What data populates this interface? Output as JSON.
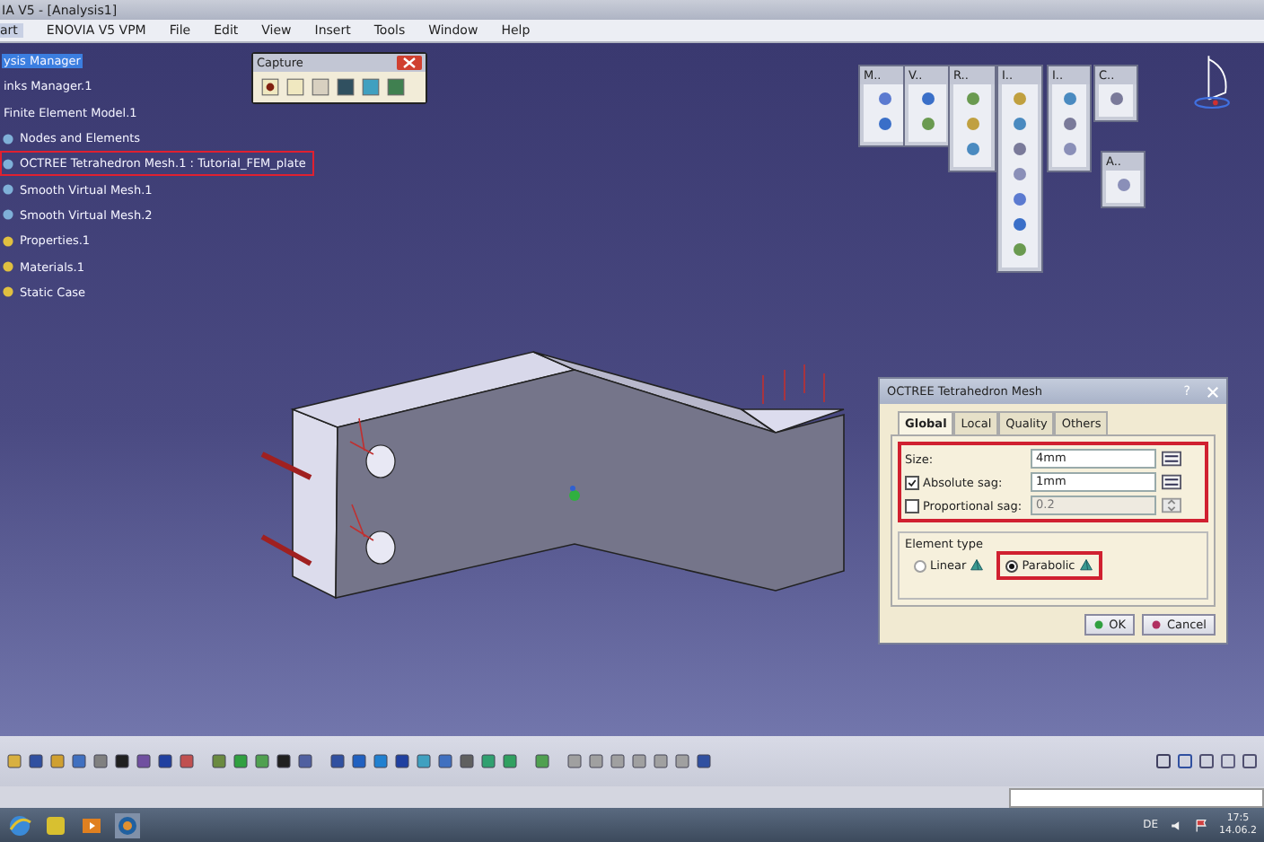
{
  "window": {
    "title": "IA V5 - [Analysis1]"
  },
  "menu": [
    {
      "label": "art",
      "selected": true
    },
    {
      "label": "ENOVIA V5 VPM",
      "selected": false
    },
    {
      "label": "File",
      "selected": false
    },
    {
      "label": "Edit",
      "selected": false
    },
    {
      "label": "View",
      "selected": false
    },
    {
      "label": "Insert",
      "selected": false
    },
    {
      "label": "Tools",
      "selected": false
    },
    {
      "label": "Window",
      "selected": false
    },
    {
      "label": "Help",
      "selected": false
    }
  ],
  "tree": [
    {
      "label": "ysis Manager",
      "selected": true,
      "highlighted": false
    },
    {
      "label": "inks Manager.1",
      "selected": false,
      "highlighted": false
    },
    {
      "label": "Finite Element Model.1",
      "selected": false,
      "highlighted": false
    },
    {
      "label": "Nodes and Elements",
      "selected": false,
      "highlighted": false
    },
    {
      "label": "OCTREE Tetrahedron Mesh.1 : Tutorial_FEM_plate",
      "selected": false,
      "highlighted": true
    },
    {
      "label": "Smooth Virtual Mesh.1",
      "selected": false,
      "highlighted": false
    },
    {
      "label": "Smooth Virtual Mesh.2",
      "selected": false,
      "highlighted": false
    },
    {
      "label": "Properties.1",
      "selected": false,
      "highlighted": false
    },
    {
      "label": "Materials.1",
      "selected": false,
      "highlighted": false
    },
    {
      "label": "Static Case",
      "selected": false,
      "highlighted": false
    }
  ],
  "capture_toolbar": {
    "title": "Capture"
  },
  "floating_toolbars": [
    {
      "title": "M.."
    },
    {
      "title": "V.."
    },
    {
      "title": "R.."
    },
    {
      "title": "I.."
    },
    {
      "title": "I.."
    },
    {
      "title": "C.."
    },
    {
      "title": "A.."
    }
  ],
  "dialog": {
    "title": "OCTREE Tetrahedron Mesh",
    "help": "?",
    "tabs": [
      {
        "label": "Global",
        "selected": true
      },
      {
        "label": "Local",
        "selected": false
      },
      {
        "label": "Quality",
        "selected": false
      },
      {
        "label": "Others",
        "selected": false
      }
    ],
    "fields_highlighted": true,
    "fields": [
      {
        "kind": "plain",
        "label": "Size:",
        "value": "4mm",
        "disabled": false
      },
      {
        "kind": "checkbox",
        "label": "Absolute sag:",
        "checked": true,
        "value": "1mm",
        "disabled": false
      },
      {
        "kind": "checkbox",
        "label": "Proportional sag:",
        "checked": false,
        "value": "0.2",
        "disabled": true
      }
    ],
    "element_type": {
      "legend": "Element type",
      "options": [
        {
          "label": "Linear",
          "selected": false,
          "highlighted": false
        },
        {
          "label": "Parabolic",
          "selected": true,
          "highlighted": true
        }
      ]
    },
    "buttons": [
      "OK",
      "Cancel"
    ]
  },
  "taskbar": {
    "language": "DE",
    "time": "17:5",
    "date": "14.06.2"
  }
}
